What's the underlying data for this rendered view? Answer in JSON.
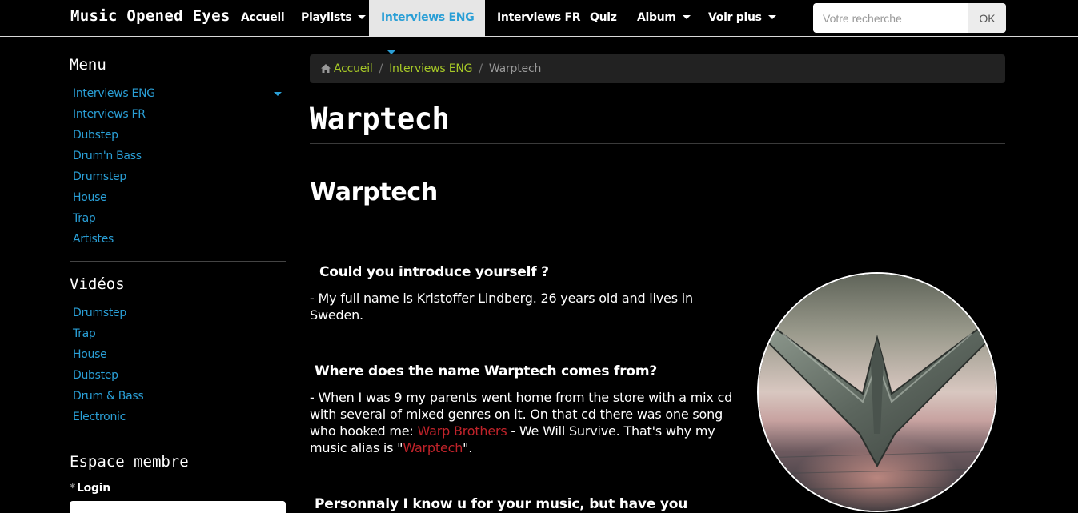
{
  "navbar": {
    "brand": "Music Opened Eyes",
    "items": [
      {
        "label": "Accueil"
      },
      {
        "label": "Playlists"
      },
      {
        "label": "Interviews ENG"
      },
      {
        "label": "Interviews FR"
      },
      {
        "label": "Quiz"
      },
      {
        "label": "Album"
      },
      {
        "label": "Voir plus"
      }
    ],
    "search": {
      "placeholder": "Votre recherche",
      "value": "",
      "button_label": "OK"
    }
  },
  "sidebar": {
    "menu_title": "Menu",
    "menu_items": [
      {
        "label": "Interviews ENG"
      },
      {
        "label": "Interviews FR"
      },
      {
        "label": "Dubstep"
      },
      {
        "label": "Drum'n Bass"
      },
      {
        "label": "Drumstep"
      },
      {
        "label": "House"
      },
      {
        "label": "Trap"
      },
      {
        "label": "Artistes"
      }
    ],
    "videos_title": "Vidéos",
    "video_items": [
      {
        "label": "Drumstep"
      },
      {
        "label": "Trap"
      },
      {
        "label": "House"
      },
      {
        "label": "Dubstep"
      },
      {
        "label": "Drum & Bass"
      },
      {
        "label": "Electronic"
      }
    ],
    "member_title": "Espace membre",
    "login_label": "Login"
  },
  "breadcrumb": {
    "home": "Accueil",
    "section": "Interviews ENG",
    "current": "Warptech"
  },
  "main": {
    "page_title": "Warptech",
    "sub_title": "Warptech",
    "qa": [
      {
        "question": "Could you introduce yourself ?",
        "answer": " - My full name is Kristoffer Lindberg. 26 years old and lives in Sweden."
      },
      {
        "question": "Where does the name Warptech comes from?",
        "answer_before": " - When I was 9 my parents went home from the store with a mix cd with several of mixed genres on it. On that cd there was one song who hooked me: ",
        "answer_link1": "Warp Brothers",
        "answer_middle": " - We Will Survive. That's why my music alias is \"",
        "answer_link2": "Warptech",
        "answer_after": "\"."
      },
      {
        "question": "Personnaly I know u for your music, but have you"
      }
    ]
  },
  "colors": {
    "link_blue": "#2a9fd6",
    "breadcrumb_green": "#a6c827",
    "red_link": "#c0232a",
    "active_tab_bg": "#e6e6e6"
  }
}
